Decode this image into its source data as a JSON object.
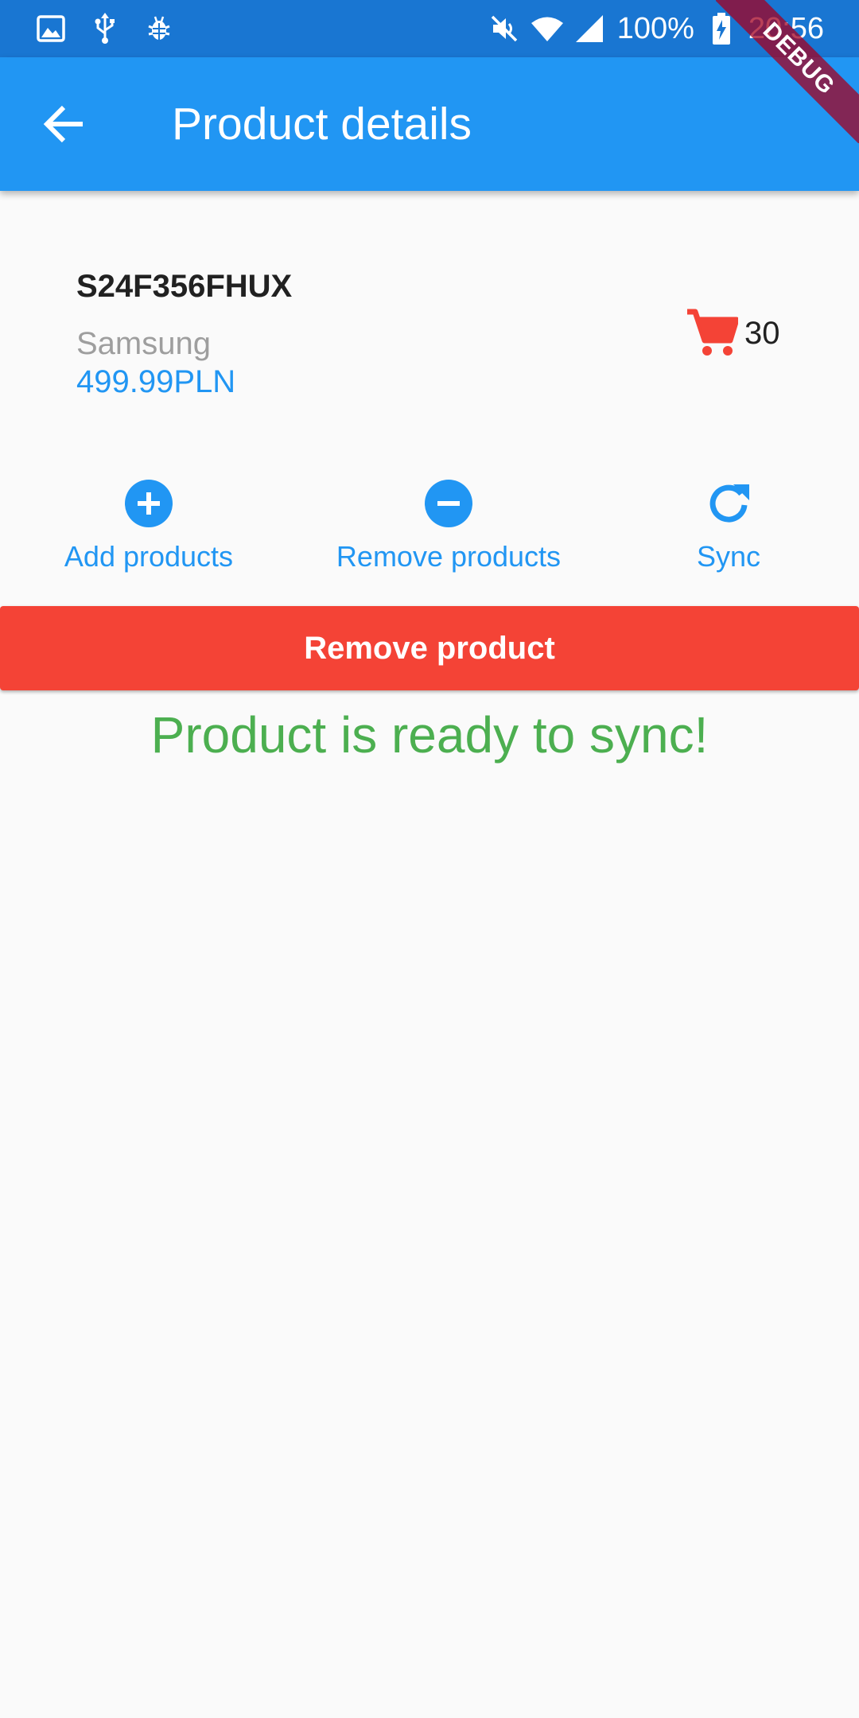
{
  "status_bar": {
    "left_icons": [
      "gallery-icon",
      "usb-icon",
      "bug-icon"
    ],
    "right_icons": [
      "mute-icon",
      "wifi-icon",
      "signal-icon",
      "battery-charging-icon"
    ],
    "battery": "100%",
    "time": "20:56"
  },
  "app_bar": {
    "title": "Product details",
    "back_icon": "arrow-back-icon",
    "color": "#2196f3"
  },
  "debug_banner": "DEBUG",
  "product": {
    "name": "S24F356FHUX",
    "brand": "Samsung",
    "price": "499.99PLN",
    "stock_icon": "shopping-cart-icon",
    "stock_count": "30"
  },
  "actions": {
    "add_label": "Add products",
    "remove_label": "Remove products",
    "sync_label": "Sync"
  },
  "remove_product_label": "Remove product",
  "sync_status": "Product is ready to sync!",
  "colors": {
    "primary": "#2196f3",
    "status_bar": "#1976d2",
    "danger": "#f44336",
    "success": "#4caf50",
    "cart": "#f44336"
  }
}
